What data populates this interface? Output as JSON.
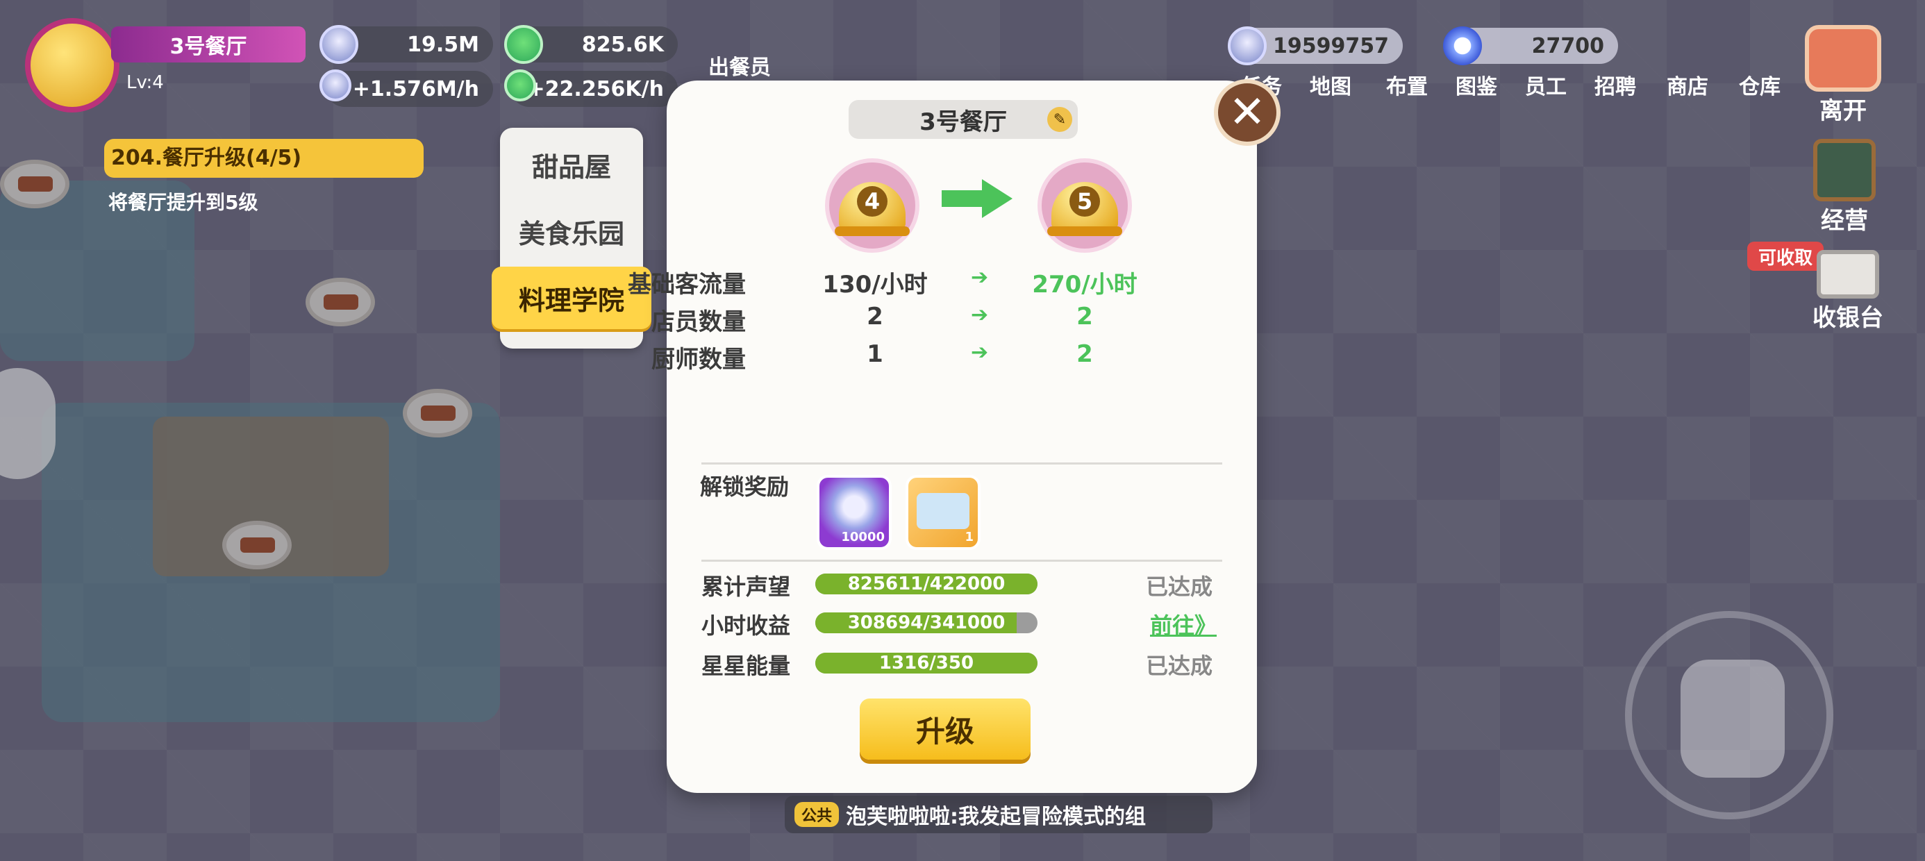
{
  "player": {
    "restaurant_name": "3号餐厅",
    "level": "Lv:4"
  },
  "resources": {
    "coins": "19.5M",
    "coins_rate": "+1.576M/h",
    "likes": "825.6K",
    "likes_rate": "+22.256K/h",
    "bell_currency": "19599757",
    "ring_currency": "27700"
  },
  "top_nav": {
    "waiter_out": "出餐员",
    "items": [
      "任务",
      "地图",
      "布置",
      "图鉴",
      "员工",
      "招聘",
      "商店",
      "仓库"
    ]
  },
  "right_menu": {
    "leave": "离开",
    "manage": "经营",
    "claimable": "可收取",
    "cashier": "收银台"
  },
  "quest": {
    "title": "204.餐厅升级(4/5)",
    "desc": "将餐厅提升到5级"
  },
  "category_tabs": [
    "甜品屋",
    "美食乐园",
    "料理学院"
  ],
  "panel": {
    "title": "3号餐厅",
    "from_level": "4",
    "to_level": "5",
    "stats": [
      {
        "label": "基础客流量",
        "from": "130/小时",
        "to": "270/小时"
      },
      {
        "label": "店员数量",
        "from": "2",
        "to": "2"
      },
      {
        "label": "厨师数量",
        "from": "1",
        "to": "2"
      }
    ],
    "reward_label": "解锁奖励",
    "rewards": [
      {
        "name": "bell-currency-reward-icon",
        "count": "10000"
      },
      {
        "name": "ticket-reward-icon",
        "count": "1"
      }
    ],
    "requirements": [
      {
        "label": "累计声望",
        "progress": "825611/422000",
        "fraction": 1.0,
        "status": "已达成"
      },
      {
        "label": "小时收益",
        "progress": "308694/341000",
        "fraction": 0.905,
        "status": "前往》"
      },
      {
        "label": "星星能量",
        "progress": "1316/350",
        "fraction": 1.0,
        "status": "已达成"
      }
    ],
    "upgrade_button": "升级"
  },
  "chat": {
    "channel": "公共",
    "message": "泡芙啦啦啦:我发起冒险模式的组"
  }
}
